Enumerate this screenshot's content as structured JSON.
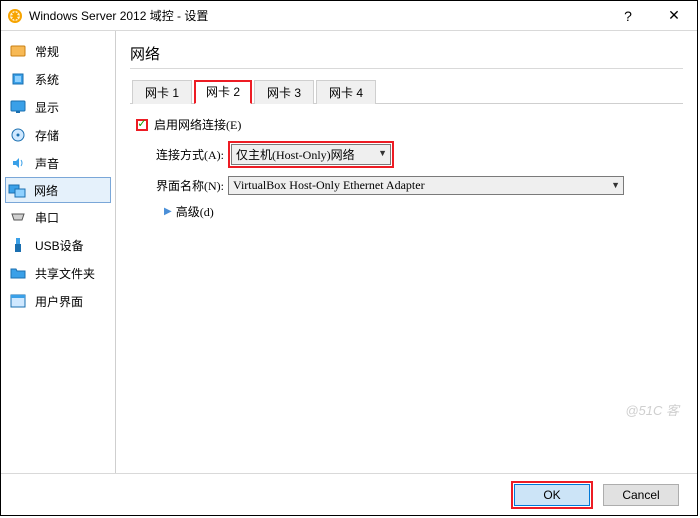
{
  "window": {
    "title": "Windows Server 2012 域控 - 设置",
    "help": "?",
    "close": "✕"
  },
  "sidebar": {
    "items": [
      {
        "label": "常规"
      },
      {
        "label": "系统"
      },
      {
        "label": "显示"
      },
      {
        "label": "存储"
      },
      {
        "label": "声音"
      },
      {
        "label": "网络"
      },
      {
        "label": "串口"
      },
      {
        "label": "USB设备"
      },
      {
        "label": "共享文件夹"
      },
      {
        "label": "用户界面"
      }
    ]
  },
  "main": {
    "heading": "网络",
    "tabs": [
      "网卡 1",
      "网卡 2",
      "网卡 3",
      "网卡 4"
    ],
    "active_tab": 1,
    "enable_label": "启用网络连接(E)",
    "attach_label": "连接方式(A):",
    "attach_value": "仅主机(Host-Only)网络",
    "iface_label": "界面名称(N):",
    "iface_value": "VirtualBox Host-Only Ethernet Adapter",
    "advanced_label": "高级(d)"
  },
  "footer": {
    "ok": "OK",
    "cancel": "Cancel"
  },
  "watermark": "@51C 客"
}
